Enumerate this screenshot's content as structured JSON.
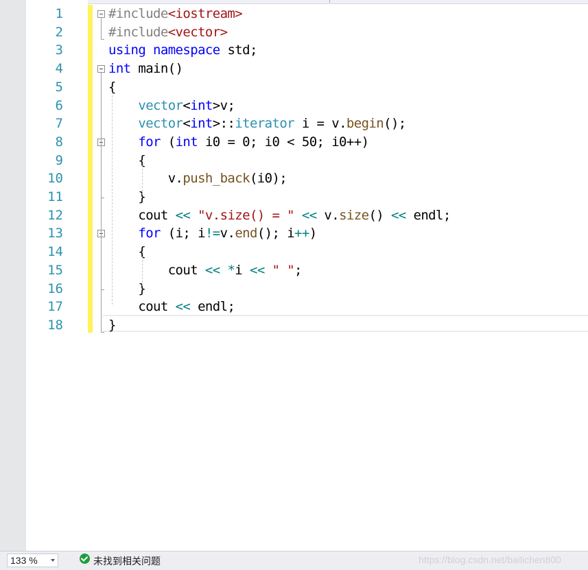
{
  "editor": {
    "line_numbers": [
      "1",
      "2",
      "3",
      "4",
      "5",
      "6",
      "7",
      "8",
      "9",
      "10",
      "11",
      "12",
      "13",
      "14",
      "15",
      "16",
      "17",
      "18"
    ],
    "lines": [
      [
        [
          "pp",
          "#include"
        ],
        [
          "inc",
          "<iostream>"
        ]
      ],
      [
        [
          "pp",
          "#include"
        ],
        [
          "inc",
          "<vector>"
        ]
      ],
      [
        [
          "kw",
          "using"
        ],
        [
          "t",
          " "
        ],
        [
          "kw",
          "namespace"
        ],
        [
          "t",
          " std;"
        ]
      ],
      [
        [
          "kw",
          "int"
        ],
        [
          "t",
          " main()"
        ]
      ],
      [
        [
          "t",
          "{"
        ]
      ],
      [
        [
          "t",
          "    "
        ],
        [
          "ty",
          "vector"
        ],
        [
          "t",
          "<"
        ],
        [
          "kw",
          "int"
        ],
        [
          "t",
          ">v;"
        ]
      ],
      [
        [
          "t",
          "    "
        ],
        [
          "ty",
          "vector"
        ],
        [
          "t",
          "<"
        ],
        [
          "kw",
          "int"
        ],
        [
          "t",
          ">::"
        ],
        [
          "ty",
          "iterator"
        ],
        [
          "t",
          " i = v."
        ],
        [
          "fn",
          "begin"
        ],
        [
          "t",
          "();"
        ]
      ],
      [
        [
          "t",
          "    "
        ],
        [
          "kw",
          "for"
        ],
        [
          "t",
          " ("
        ],
        [
          "kw",
          "int"
        ],
        [
          "t",
          " i0 = 0; i0 < 50; i0++)"
        ]
      ],
      [
        [
          "t",
          "    {"
        ]
      ],
      [
        [
          "t",
          "        v."
        ],
        [
          "fn",
          "push_back"
        ],
        [
          "t",
          "(i0);"
        ]
      ],
      [
        [
          "t",
          "    }"
        ]
      ],
      [
        [
          "t",
          "    cout "
        ],
        [
          "op",
          "<<"
        ],
        [
          "t",
          " "
        ],
        [
          "str",
          "\"v.size() = \""
        ],
        [
          "t",
          " "
        ],
        [
          "op",
          "<<"
        ],
        [
          "t",
          " v."
        ],
        [
          "fn",
          "size"
        ],
        [
          "t",
          "() "
        ],
        [
          "op",
          "<<"
        ],
        [
          "t",
          " endl;"
        ]
      ],
      [
        [
          "t",
          "    "
        ],
        [
          "kw",
          "for"
        ],
        [
          "t",
          " (i; i"
        ],
        [
          "op",
          "!="
        ],
        [
          "t",
          "v."
        ],
        [
          "fn",
          "end"
        ],
        [
          "t",
          "(); i"
        ],
        [
          "op",
          "++"
        ],
        [
          "t",
          ")"
        ]
      ],
      [
        [
          "t",
          "    {"
        ]
      ],
      [
        [
          "t",
          "        cout "
        ],
        [
          "op",
          "<<"
        ],
        [
          "t",
          " "
        ],
        [
          "op",
          "*"
        ],
        [
          "t",
          "i "
        ],
        [
          "op",
          "<<"
        ],
        [
          "t",
          " "
        ],
        [
          "str",
          "\" \""
        ],
        [
          "t",
          ";"
        ]
      ],
      [
        [
          "t",
          "    }"
        ]
      ],
      [
        [
          "t",
          "    cout "
        ],
        [
          "op",
          "<<"
        ],
        [
          "t",
          " endl;"
        ]
      ],
      [
        [
          "t",
          "}"
        ]
      ]
    ],
    "fold_lines": [
      1,
      4,
      8,
      13
    ],
    "current_line": 18
  },
  "statusbar": {
    "zoom_value": "133 %",
    "issues_text": "未找到相关问题",
    "watermark": "https://blog.csdn.net/bailichen800"
  },
  "colors": {
    "keyword": "#0000ff",
    "type": "#2b91af",
    "string": "#a31515",
    "line_number": "#2b91af",
    "change_marker": "#fff25a",
    "status_ok": "#1f9d3f"
  },
  "icons": {
    "fold": "minus-box-icon",
    "status": "check-circle-icon",
    "zoom_dropdown": "chevron-down-icon"
  }
}
